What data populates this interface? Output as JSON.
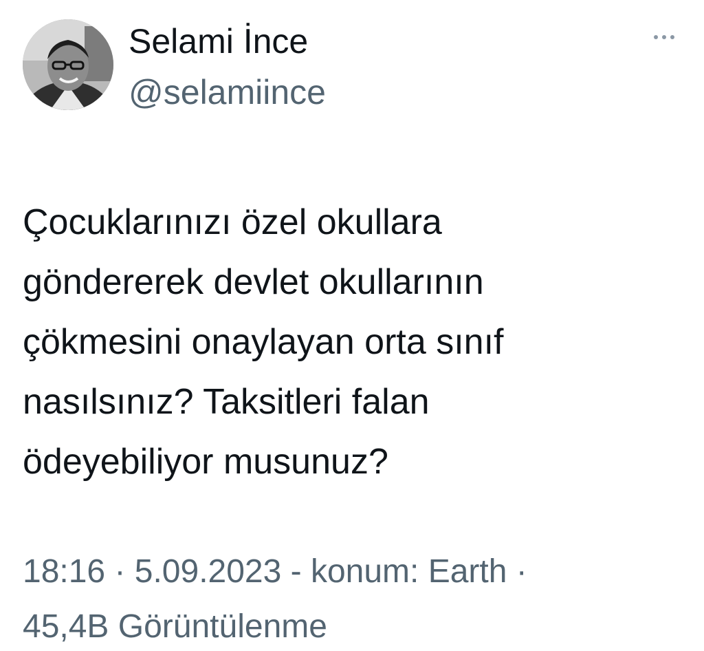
{
  "tweet": {
    "author": {
      "display_name": "Selami İnce",
      "handle": "@selamiince",
      "avatar": "profile-photo"
    },
    "more_icon": "more-horizontal-icon",
    "text": "Çocuklarınızı özel okullara\ngöndererek devlet okullarının\nçökmesini onaylayan orta sınıf\nnasılsınız? Taksitleri falan\nödeyebiliyor musunuz?",
    "meta_line": "18:16 · 5.09.2023 - konum: Earth ·",
    "meta_line_2": "45,4B Görüntülenme"
  }
}
